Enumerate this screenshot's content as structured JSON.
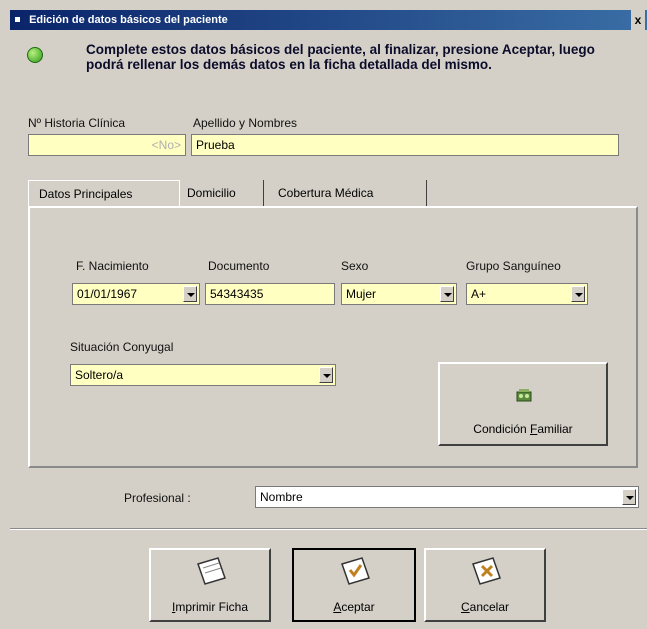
{
  "window": {
    "title": "Edición de datos básicos del paciente",
    "close": "x"
  },
  "instructions": "Complete estos datos básicos del paciente, al finalizar, presione Aceptar, luego podrá rellenar los demás datos en la ficha detallada del mismo.",
  "header": {
    "historia_label": "Nº Historia Clínica",
    "historia_value": "<No>",
    "apellido_label": "Apellido y Nombres",
    "apellido_value": "Prueba"
  },
  "tabs": [
    {
      "label": "Datos Principales"
    },
    {
      "label": "Domicilio"
    },
    {
      "label": "Cobertura Médica"
    }
  ],
  "form": {
    "nacimiento_label": "F. Nacimiento",
    "nacimiento_value": "01/01/1967",
    "documento_label": "Documento",
    "documento_value": "54343435",
    "sexo_label": "Sexo",
    "sexo_value": "Mujer",
    "grupo_label": "Grupo Sanguíneo",
    "grupo_value": "A+",
    "conyugal_label": "Situación Conyugal",
    "conyugal_value": "Soltero/a",
    "condicion_label": "Condición Familiar",
    "condicion_key": "F"
  },
  "profesional": {
    "label": "Profesional :",
    "value": "Nombre"
  },
  "buttons": {
    "imprimir": {
      "key": "I",
      "rest": "mprimir Ficha"
    },
    "aceptar": {
      "key": "A",
      "rest": "ceptar"
    },
    "cancelar": {
      "key": "C",
      "rest": "ancelar"
    }
  }
}
